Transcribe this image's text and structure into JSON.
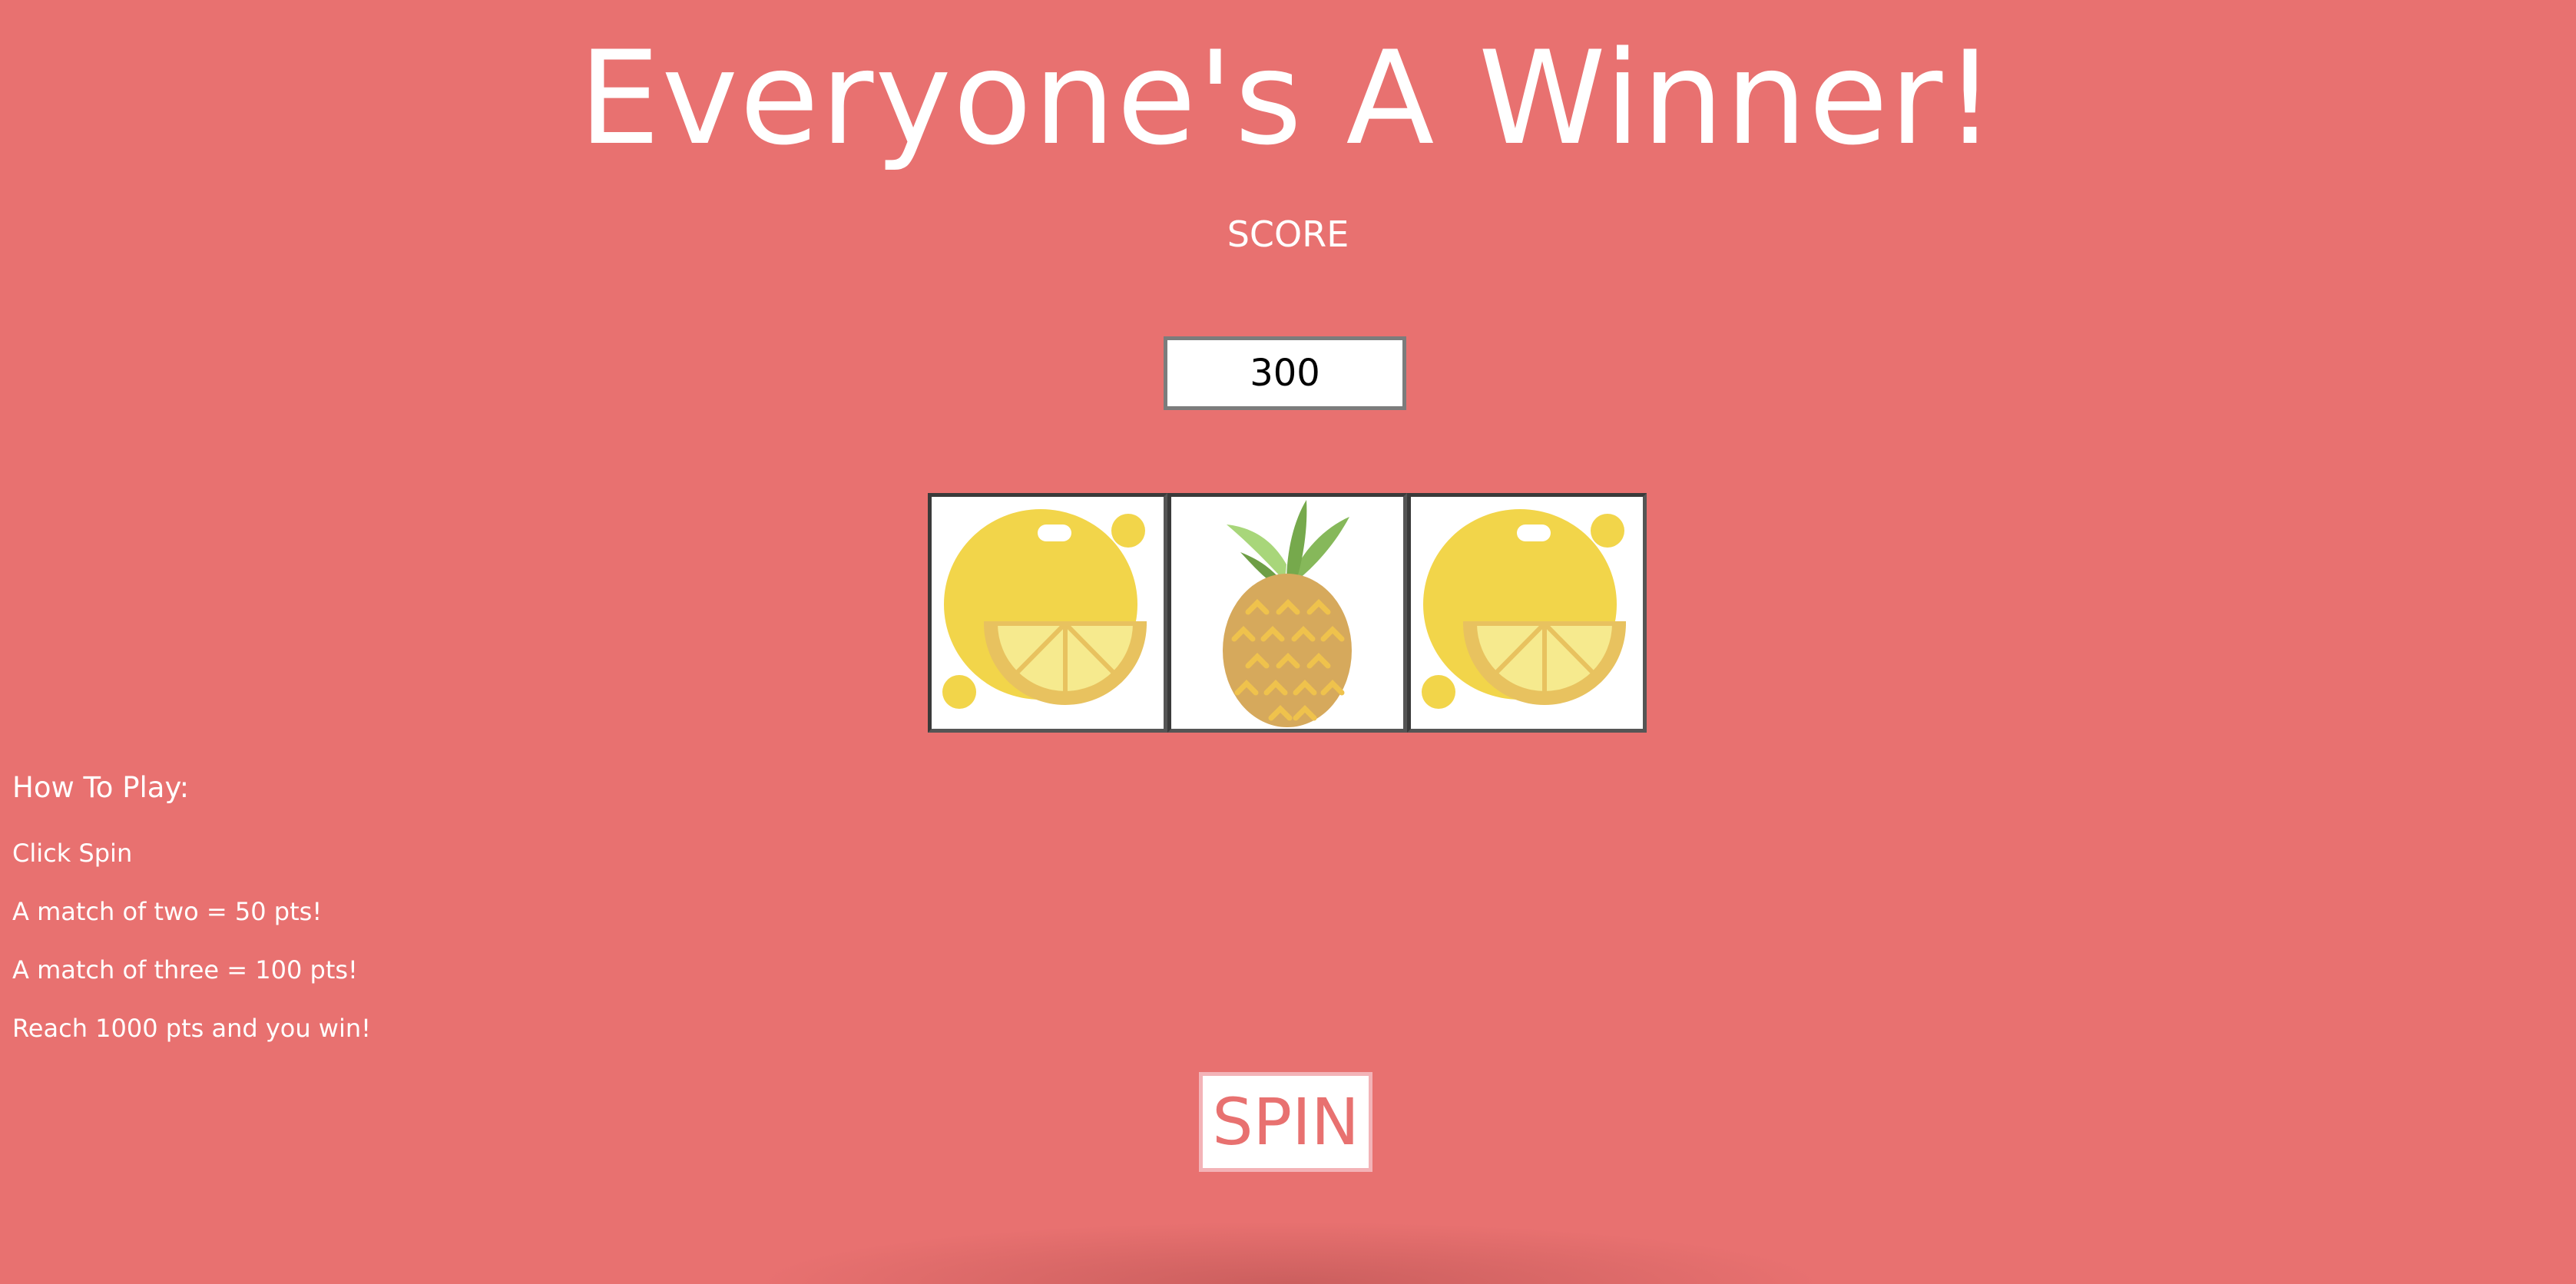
{
  "game": {
    "title": "Everyone's A Winner!",
    "score_label": "SCORE",
    "score_value": "300",
    "reels": [
      {
        "symbol": "lemon-icon"
      },
      {
        "symbol": "pineapple-icon"
      },
      {
        "symbol": "lemon-icon"
      }
    ],
    "spin_label": "SPIN"
  },
  "instructions": {
    "heading": "How To Play:",
    "rules": [
      "Click Spin",
      "A match of two = 50 pts!",
      "A match of three = 100 pts!",
      "Reach 1000 pts and you win!"
    ]
  },
  "colors": {
    "background": "#e87170",
    "text": "#ffffff",
    "lemon": "#f2d54a",
    "pineapple": "#d6a95c"
  }
}
